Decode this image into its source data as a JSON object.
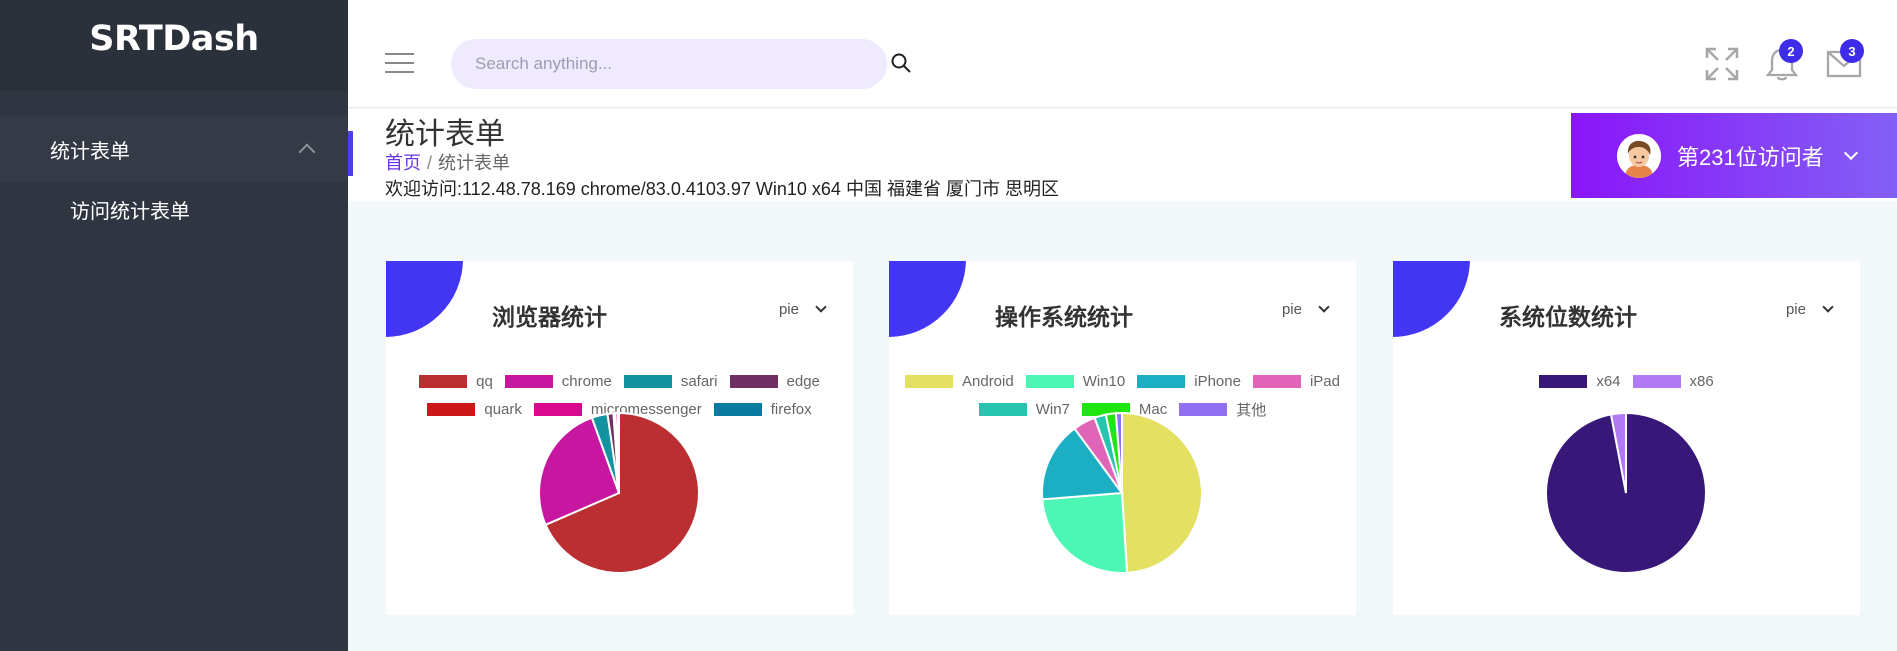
{
  "brand": "SRTDash",
  "sidebar": {
    "menu_label": "统计表单",
    "sub_items": [
      "访问统计表单"
    ]
  },
  "header": {
    "search_placeholder": "Search anything...",
    "notifications_count": "2",
    "messages_count": "3"
  },
  "page": {
    "title": "统计表单",
    "breadcrumb_home": "首页",
    "breadcrumb_sep": "/",
    "breadcrumb_current": "统计表单",
    "welcome": "欢迎访问:112.48.78.169 chrome/83.0.4103.97 Win10 x64 中国 福建省 厦门市 思明区"
  },
  "user": {
    "name": "第231位访问者"
  },
  "colors": {
    "accent": "#4336f3",
    "user_panel_start": "#8a15f8",
    "user_panel_end": "#8360f6",
    "sidebar": "#303641"
  },
  "chart_data": [
    {
      "type": "pie",
      "title": "浏览器统计",
      "selector": "pie",
      "legend_rows": [
        [
          "qq",
          "chrome",
          "safari",
          "edge"
        ],
        [
          "quark",
          "micromessenger",
          "firefox"
        ]
      ],
      "series": [
        {
          "name": "qq",
          "value": 68.5,
          "color": "#bb2f33"
        },
        {
          "name": "chrome",
          "value": 26,
          "color": "#c7169f"
        },
        {
          "name": "safari",
          "value": 3.2,
          "color": "#13939f"
        },
        {
          "name": "edge",
          "value": 1.2,
          "color": "#6e2f62"
        },
        {
          "name": "quark",
          "value": 0.3,
          "color": "#cc1818"
        },
        {
          "name": "micromessenger",
          "value": 0.5,
          "color": "#d9088c"
        },
        {
          "name": "firefox",
          "value": 0.3,
          "color": "#0a7ba0"
        }
      ]
    },
    {
      "type": "pie",
      "title": "操作系统统计",
      "selector": "pie",
      "legend_rows": [
        [
          "Android",
          "Win10",
          "iPhone",
          "iPad"
        ],
        [
          "Win7",
          "Mac",
          "其他"
        ]
      ],
      "series": [
        {
          "name": "Android",
          "value": 48.5,
          "color": "#e3e062"
        },
        {
          "name": "Win10",
          "value": 24.5,
          "color": "#4cf7b5"
        },
        {
          "name": "iPhone",
          "value": 16,
          "color": "#1caec3"
        },
        {
          "name": "iPad",
          "value": 4.5,
          "color": "#e065b8"
        },
        {
          "name": "Win7",
          "value": 2.3,
          "color": "#27c4b0"
        },
        {
          "name": "Mac",
          "value": 2.0,
          "color": "#1ee60e"
        },
        {
          "name": "其他",
          "value": 1.2,
          "color": "#8f6ff2"
        }
      ]
    },
    {
      "type": "pie",
      "title": "系统位数统计",
      "selector": "pie",
      "legend_rows": [
        [
          "x64",
          "x86"
        ]
      ],
      "series": [
        {
          "name": "x64",
          "value": 97,
          "color": "#371879"
        },
        {
          "name": "x86",
          "value": 3,
          "color": "#b07af5"
        }
      ]
    }
  ]
}
